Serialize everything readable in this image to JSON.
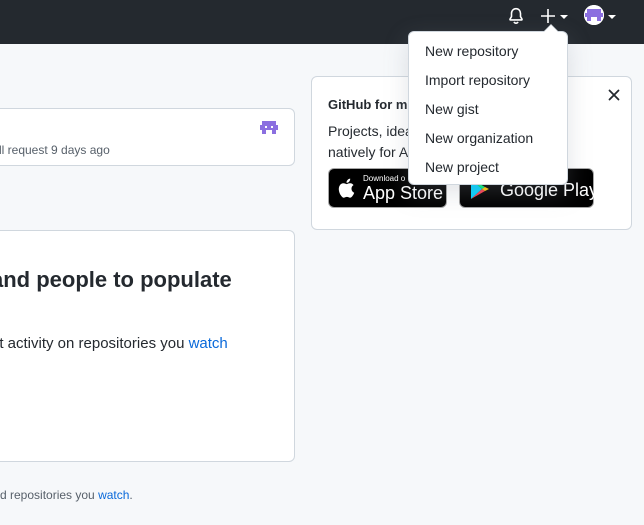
{
  "header": {
    "icons": [
      "bell-icon",
      "plus-icon",
      "avatar"
    ]
  },
  "create_menu": {
    "items": [
      "New repository",
      "Import repository",
      "New gist",
      "New organization",
      "New project"
    ]
  },
  "feed": {
    "activity_meta": "ll request 9 days ago",
    "empty_heading": "and people to populate",
    "empty_desc_prefix": "nt activity on repositories you ",
    "empty_desc_link": "watch",
    "footnote_prefix": "d repositories you ",
    "footnote_link": "watch",
    "footnote_suffix": "."
  },
  "promo": {
    "title": "GitHub for m",
    "body_line1": "Projects, idea",
    "body_line2": "natively for A",
    "appstore_small": "Download o",
    "appstore_big": "App Store",
    "gplay_big": "Google Play"
  },
  "colors": {
    "header_bg": "#24292f",
    "page_bg": "#f6f8fa",
    "link": "#0969da",
    "avatar_purple": "#8b6fe0"
  }
}
